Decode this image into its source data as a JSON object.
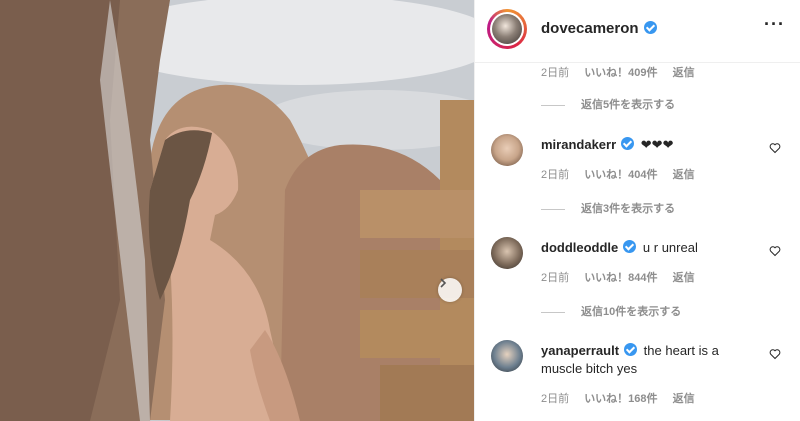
{
  "post": {
    "photo_alt": "",
    "next_icon": "chevron-right-icon"
  },
  "header": {
    "username": "dovecameron",
    "more_label": "···"
  },
  "top_meta": {
    "time": "2日前",
    "likes": "いいね！409件",
    "reply": "返信"
  },
  "top_view_replies": "返信5件を表示する",
  "comments": [
    {
      "user": "mirandakerr",
      "text": "❤❤❤",
      "time": "2日前",
      "likes": "いいね！404件",
      "reply": "返信",
      "view_replies": "返信3件を表示する",
      "avatar_color": "#c8a58a"
    },
    {
      "user": "doddleoddle",
      "text": "u r unreal",
      "time": "2日前",
      "likes": "いいね！844件",
      "reply": "返信",
      "view_replies": "返信10件を表示する",
      "avatar_color": "#7d6a5a"
    },
    {
      "user": "yanaperrault",
      "text": "the heart is a muscle bitch yes",
      "time": "2日前",
      "likes": "いいね！168件",
      "reply": "返信",
      "view_replies": "",
      "avatar_color": "#6d7f8f"
    }
  ]
}
